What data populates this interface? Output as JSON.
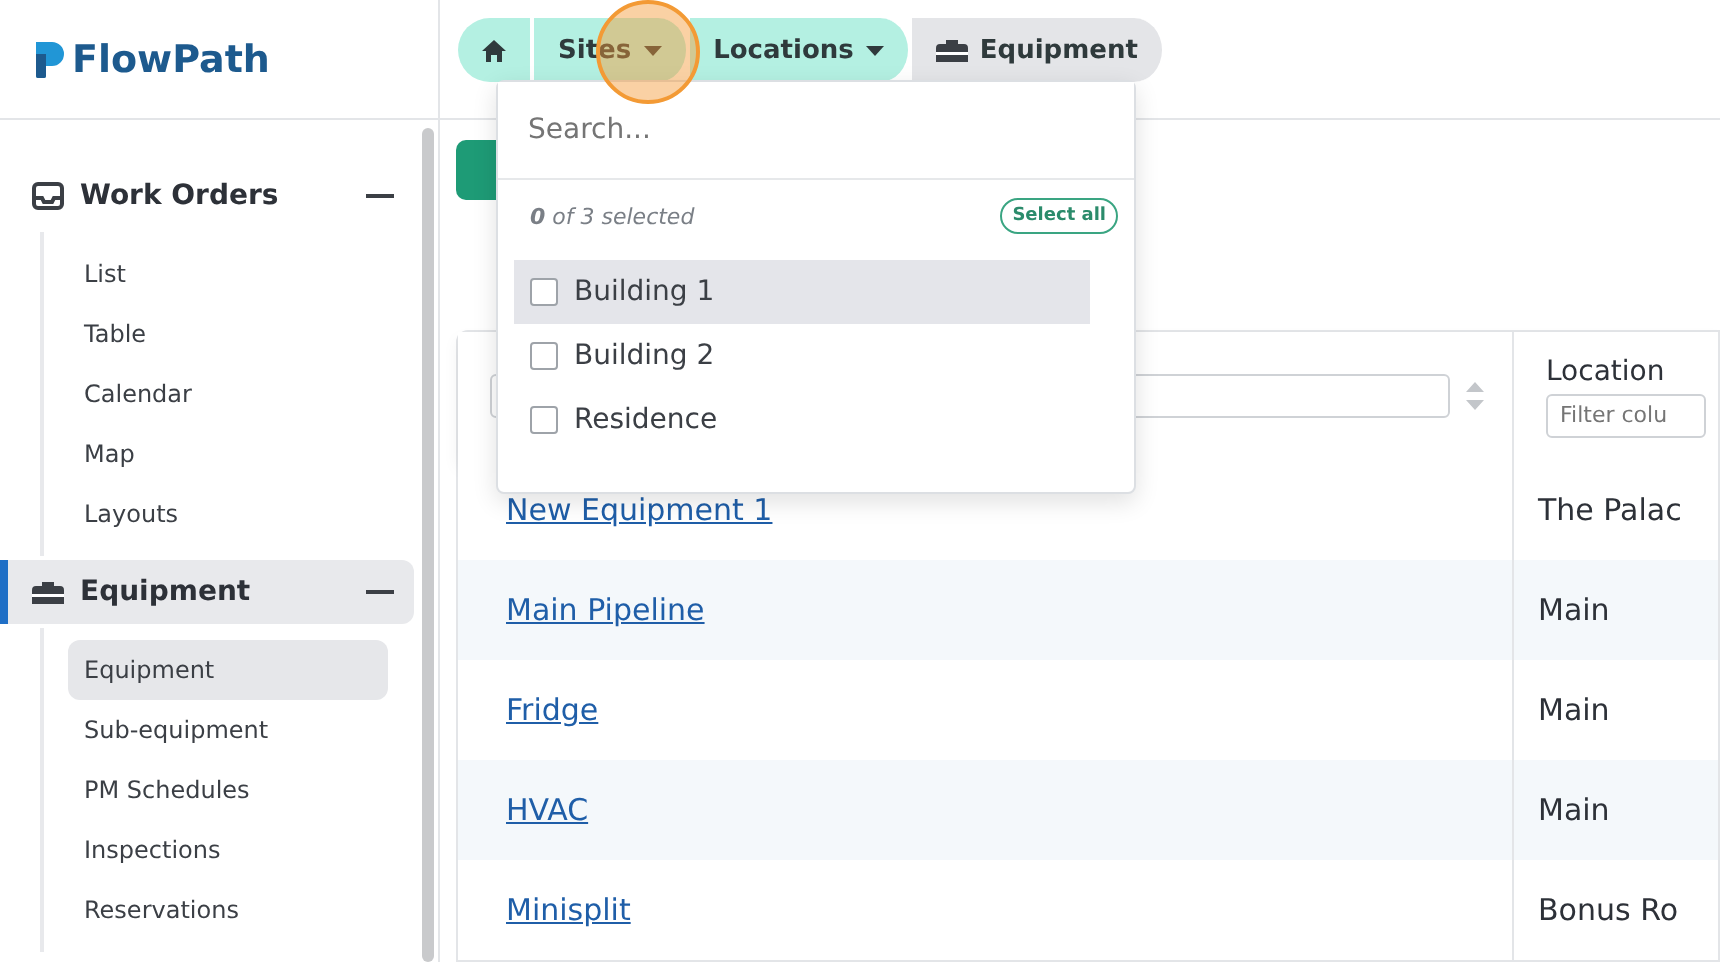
{
  "brand": {
    "name": "FlowPath"
  },
  "sidebar": {
    "groups": [
      {
        "label": "Work Orders",
        "selected": false,
        "expanded": true,
        "items": [
          {
            "label": "List",
            "selected": false
          },
          {
            "label": "Table",
            "selected": false
          },
          {
            "label": "Calendar",
            "selected": false
          },
          {
            "label": "Map",
            "selected": false
          },
          {
            "label": "Layouts",
            "selected": false
          }
        ]
      },
      {
        "label": "Equipment",
        "selected": true,
        "expanded": true,
        "items": [
          {
            "label": "Equipment",
            "selected": true
          },
          {
            "label": "Sub-equipment",
            "selected": false
          },
          {
            "label": "PM Schedules",
            "selected": false
          },
          {
            "label": "Inspections",
            "selected": false
          },
          {
            "label": "Reservations",
            "selected": false
          }
        ]
      }
    ]
  },
  "breadcrumb": [
    {
      "kind": "home",
      "active": true
    },
    {
      "kind": "menu",
      "label": "Sites",
      "active": true
    },
    {
      "kind": "menu",
      "label": "Locations",
      "active": true
    },
    {
      "kind": "current",
      "label": "Equipment",
      "active": false
    }
  ],
  "dropdown": {
    "search_placeholder": "Search...",
    "count": "0",
    "count_suffix": " of 3 selected",
    "select_all": "Select all",
    "options": [
      {
        "label": "Building 1",
        "checked": false,
        "highlighted": true
      },
      {
        "label": "Building 2",
        "checked": false,
        "highlighted": false
      },
      {
        "label": "Residence",
        "checked": false,
        "highlighted": false
      }
    ]
  },
  "table": {
    "columns": [
      {},
      {
        "label": "Location",
        "filter_placeholder": "Filter colu"
      }
    ],
    "rows": [
      {
        "name": "New Equipment 1",
        "location": "The Palac"
      },
      {
        "name": "Main Pipeline",
        "location": "Main"
      },
      {
        "name": "Fridge",
        "location": "Main"
      },
      {
        "name": "HVAC",
        "location": "Main"
      },
      {
        "name": "Minisplit",
        "location": "Bonus Ro"
      }
    ]
  }
}
